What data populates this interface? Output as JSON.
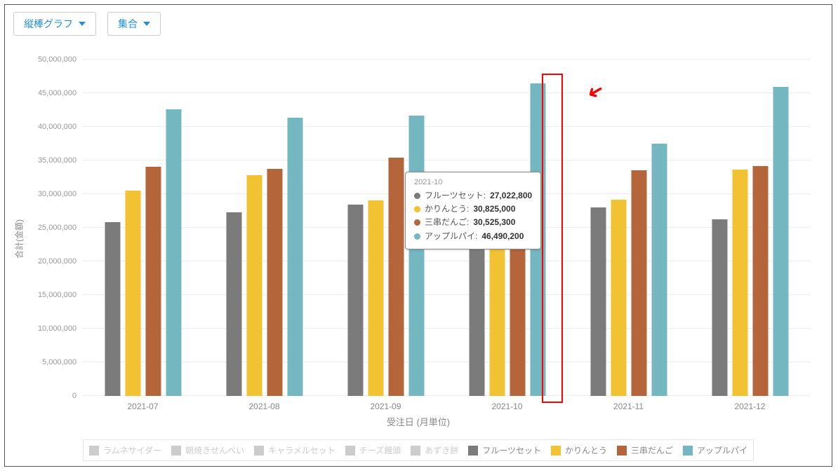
{
  "toolbar": {
    "chart_type": "縦棒グラフ",
    "grouping": "集合"
  },
  "chart_data": {
    "type": "bar",
    "xlabel": "受注日 (月単位)",
    "ylabel": "合計(金額)",
    "ylim": [
      0,
      50000000
    ],
    "ystep": 5000000,
    "categories": [
      "2021-07",
      "2021-08",
      "2021-09",
      "2021-10",
      "2021-11",
      "2021-12"
    ],
    "series": [
      {
        "name": "ラムネサイダー",
        "color": "#cccccc",
        "active": false
      },
      {
        "name": "朝焼きせんべい",
        "color": "#cccccc",
        "active": false
      },
      {
        "name": "キャラメルセット",
        "color": "#cccccc",
        "active": false
      },
      {
        "name": "チーズ饅頭",
        "color": "#cccccc",
        "active": false
      },
      {
        "name": "あずき餅",
        "color": "#cccccc",
        "active": false
      },
      {
        "name": "フルーツセット",
        "color": "#7b7b7b",
        "active": true,
        "values": [
          25800000,
          27300000,
          28400000,
          27022800,
          28000000,
          26300000
        ]
      },
      {
        "name": "かりんとう",
        "color": "#f1c232",
        "active": true,
        "values": [
          30500000,
          32800000,
          29100000,
          30825000,
          29200000,
          33600000
        ]
      },
      {
        "name": "三串だんご",
        "color": "#b4653a",
        "active": true,
        "values": [
          34100000,
          33800000,
          35400000,
          30525300,
          33500000,
          34200000
        ]
      },
      {
        "name": "アップルパイ",
        "color": "#74b7c1",
        "active": true,
        "values": [
          42600000,
          41400000,
          41700000,
          46490200,
          37500000,
          45900000
        ]
      }
    ]
  },
  "tooltip": {
    "category": "2021-10",
    "rows": [
      {
        "label": "フルーツセット",
        "value": "27,022,800",
        "color": "#7b7b7b"
      },
      {
        "label": "かりんとう",
        "value": "30,825,000",
        "color": "#f1c232"
      },
      {
        "label": "三串だんご",
        "value": "30,525,300",
        "color": "#b4653a"
      },
      {
        "label": "アップルパイ",
        "value": "46,490,200",
        "color": "#74b7c1"
      }
    ]
  },
  "yticks": [
    "0",
    "5,000,000",
    "10,000,000",
    "15,000,000",
    "20,000,000",
    "25,000,000",
    "30,000,000",
    "35,000,000",
    "40,000,000",
    "45,000,000",
    "50,000,000"
  ]
}
